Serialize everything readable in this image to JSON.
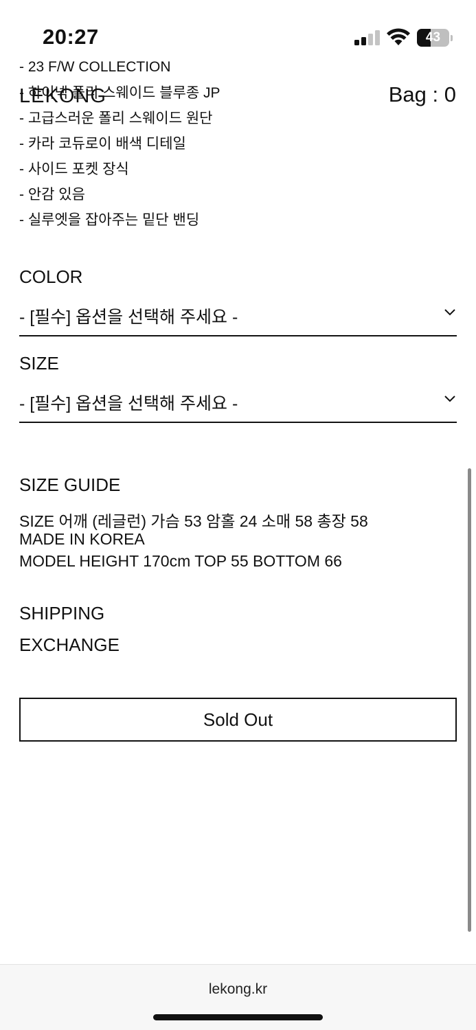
{
  "status_bar": {
    "time": "20:27",
    "battery": "43",
    "battery_level_percent": 43
  },
  "header": {
    "logo": "LEKONG",
    "bag_label": "Bag : 0"
  },
  "description": {
    "lines": [
      "- 23 F/W COLLECTION",
      "- 하이넥 폴리 스웨이드 블루종 JP",
      "- 고급스러운 폴리 스웨이드 원단",
      "- 카라 코듀로이 배색 디테일",
      "- 사이드 포켓 장식",
      "- 안감 있음",
      "- 실루엣을 잡아주는 밑단 밴딩"
    ]
  },
  "options": {
    "color": {
      "label": "COLOR",
      "value": "- [필수] 옵션을 선택해 주세요 -"
    },
    "size": {
      "label": "SIZE",
      "value": "- [필수] 옵션을 선택해 주세요 -"
    }
  },
  "size_guide": {
    "title": "SIZE GUIDE",
    "lines": [
      "SIZE 어깨 (레글런) 가슴 53 암홀 24 소매 58 총장 58",
      "MADE IN KOREA",
      "MODEL HEIGHT 170cm TOP 55 BOTTOM 66"
    ]
  },
  "links": {
    "shipping": "SHIPPING",
    "exchange": "EXCHANGE"
  },
  "buy_button": {
    "label": "Sold Out"
  },
  "browser": {
    "url": "lekong.kr"
  }
}
